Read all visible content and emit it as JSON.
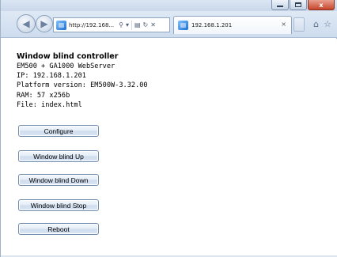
{
  "browser": {
    "address_url": "http://192.168...",
    "address_icons": [
      "search-icon",
      "compatibility-icon",
      "refresh-icon",
      "stop-icon"
    ],
    "tab_title": "192.168.1.201",
    "tab_close_glyph": "×",
    "window_controls": [
      "minimize-icon",
      "maximize-icon",
      "close-icon"
    ],
    "close_glyph": "x"
  },
  "page": {
    "title": "Window blind controller",
    "info": [
      "EM500 + GA1000 WebServer",
      "IP: 192.168.1.201",
      "Platform version: EM500W-3.32.00",
      "RAM: 57 x256b",
      "File: index.html"
    ],
    "buttons": [
      "Configure",
      "Window blind Up",
      "Window blind Down",
      "Window blind Stop",
      "Reboot"
    ]
  },
  "colors": {
    "button_border": "#6f8caf",
    "chrome_blue": "#cddcee",
    "close_red": "#c7452c"
  }
}
